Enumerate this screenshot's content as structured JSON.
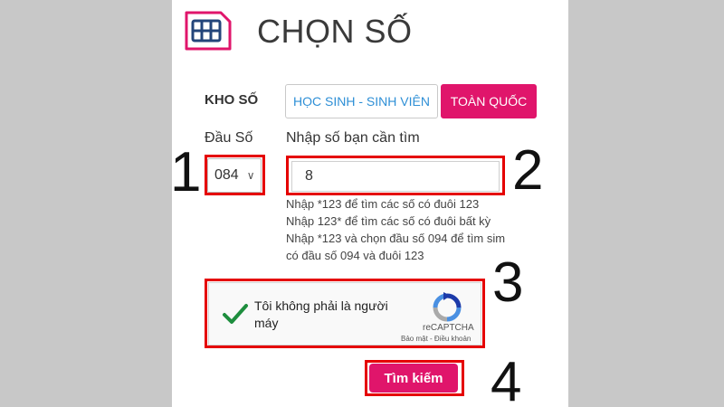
{
  "header": {
    "title": "CHỌN SỐ",
    "icon": "sim-card-icon"
  },
  "store": {
    "label": "KHO SỐ",
    "tabs": [
      {
        "label": "HỌC SINH - SINH VIÊN",
        "active": false
      },
      {
        "label": "TOÀN QUỐC",
        "active": true
      }
    ]
  },
  "prefix": {
    "label": "Đầu Số",
    "selected": "084"
  },
  "search": {
    "label": "Nhập số bạn cần tìm",
    "value": "8",
    "hints": [
      "Nhập *123 để tìm các số có đuôi 123",
      "Nhập 123* để tìm các số có đuôi bất kỳ",
      "Nhập *123 và chọn đầu số 094 để tìm sim",
      "có đầu số 094 và đuôi 123"
    ]
  },
  "captcha": {
    "label": "Tôi không phải là người máy",
    "checked": true,
    "brand": "reCAPTCHA",
    "links": "Bảo mật - Điều khoản"
  },
  "submit": {
    "label": "Tìm kiếm"
  },
  "steps": [
    "1",
    "2",
    "3",
    "4"
  ],
  "colors": {
    "accent": "#e0156b",
    "highlight": "#e50000",
    "link": "#2e8fd6",
    "check": "#1e8e3e"
  }
}
